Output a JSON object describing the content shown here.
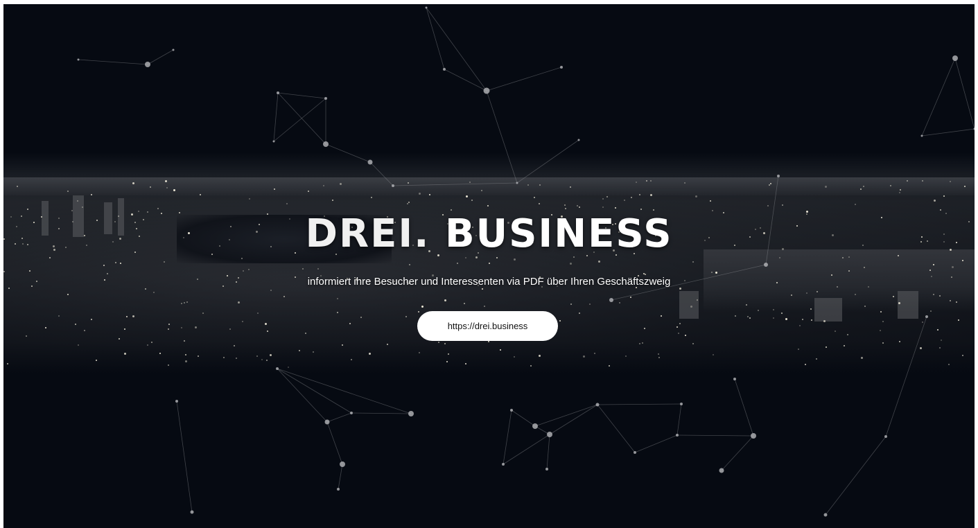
{
  "hero": {
    "title_part1": "DREI.",
    "title_part2": "BUSINESS",
    "subtitle": "informiert ihre Besucher und Interessenten via PDF über Ihren Geschäftszweig",
    "button_label": "https://drei.business"
  },
  "colors": {
    "background": "#060a12",
    "text": "#ffffff",
    "button_bg": "#ffffff",
    "button_text": "#111111",
    "network_line": "#8a8c90",
    "network_node": "#b5b7ba"
  }
}
